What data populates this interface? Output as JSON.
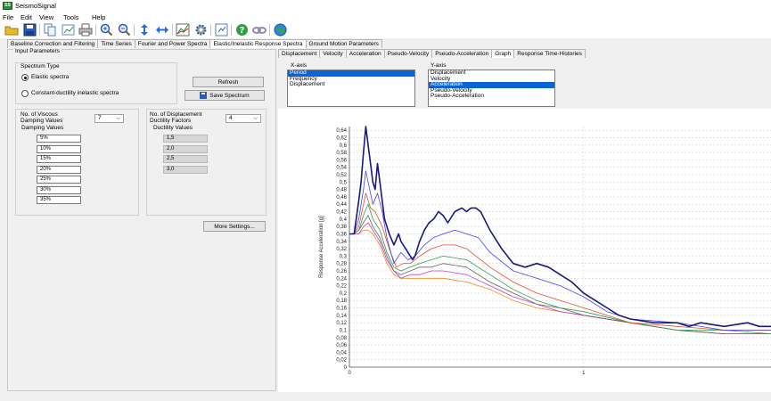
{
  "app": {
    "title": "SeismoSignal"
  },
  "menu": [
    "File",
    "Edit",
    "View",
    "Tools",
    "Help"
  ],
  "toolbar": [
    "open-folder",
    "save",
    "copy",
    "print",
    "zoom-in",
    "zoom-out",
    "vertical-arrows",
    "horizontal-arrows",
    "chart",
    "gear",
    "export",
    "help",
    "link",
    "globe"
  ],
  "main_tabs": [
    "Baseline Correction and Filtering",
    "Time Series",
    "Fourier and Power Spectra",
    "Elastic/Inelastic Response Spectra",
    "Ground Motion Parameters"
  ],
  "main_active": 3,
  "left": {
    "header": "Input Parameters",
    "spectrum_type": "Spectrum Type",
    "elastic": "Elastic spectra",
    "inelastic": "Constant-ductility inelastic spectra",
    "refresh": "Refresh",
    "save": "Save Spectrum",
    "viscous_l1": "No. of Viscous",
    "viscous_l2": "Damping Values",
    "viscous_value": "7",
    "damping_header": "Damping Values",
    "damping": [
      "5%",
      "10%",
      "15%",
      "20%",
      "25%",
      "30%",
      "35%"
    ],
    "ductility_l1": "No. of Displacement",
    "ductility_l2": "Ductility Factors",
    "ductility_value": "4",
    "ductility_header": "Ductility Values",
    "ductility": [
      "1,5",
      "2,0",
      "2,5",
      "3,0"
    ],
    "more": "More Settings..."
  },
  "sub_tabs": [
    "Displacement",
    "Velocity",
    "Acceleration",
    "Pseudo-Velocity",
    "Pseudo-Acceleration",
    "Graph",
    "Response Time-Histories"
  ],
  "sub_active": 5,
  "xaxis": {
    "label": "X-axis",
    "items": [
      "Period",
      "Frequency",
      "Displacement"
    ],
    "selected": 0
  },
  "yaxis": {
    "label": "Y-axis",
    "items": [
      "Displacement",
      "Velocity",
      "Acceleration",
      "Pseudo-Velocity",
      "Pseudo-Acceleration"
    ],
    "selected": 2
  },
  "chart_data": {
    "type": "line",
    "xlabel": "",
    "ylabel": "Response Acceleration [g]",
    "xlim": [
      0,
      1.8
    ],
    "ylim": [
      0,
      0.65
    ],
    "yticks": [
      "0",
      "0,02",
      "0,04",
      "0,06",
      "0,08",
      "0,1",
      "0,12",
      "0,14",
      "0,16",
      "0,18",
      "0,2",
      "0,22",
      "0,24",
      "0,26",
      "0,28",
      "0,3",
      "0,32",
      "0,34",
      "0,36",
      "0,38",
      "0,4",
      "0,42",
      "0,44",
      "0,46",
      "0,48",
      "0,5",
      "0,52",
      "0,54",
      "0,56",
      "0,58",
      "0,6",
      "0,62",
      "0,64"
    ],
    "xticks": [
      {
        "v": 0,
        "label": "0"
      },
      {
        "v": 1,
        "label": "1"
      }
    ],
    "grid": true,
    "series": [
      {
        "color": "#1a1a7a",
        "values": [
          [
            0,
            0.36
          ],
          [
            0.02,
            0.36
          ],
          [
            0.04,
            0.45
          ],
          [
            0.05,
            0.5
          ],
          [
            0.06,
            0.58
          ],
          [
            0.07,
            0.65
          ],
          [
            0.08,
            0.6
          ],
          [
            0.09,
            0.55
          ],
          [
            0.1,
            0.5
          ],
          [
            0.11,
            0.48
          ],
          [
            0.12,
            0.55
          ],
          [
            0.13,
            0.5
          ],
          [
            0.14,
            0.45
          ],
          [
            0.15,
            0.4
          ],
          [
            0.17,
            0.36
          ],
          [
            0.19,
            0.33
          ],
          [
            0.21,
            0.36
          ],
          [
            0.22,
            0.34
          ],
          [
            0.24,
            0.32
          ],
          [
            0.26,
            0.3
          ],
          [
            0.27,
            0.29
          ],
          [
            0.28,
            0.3
          ],
          [
            0.3,
            0.34
          ],
          [
            0.32,
            0.37
          ],
          [
            0.34,
            0.39
          ],
          [
            0.36,
            0.4
          ],
          [
            0.38,
            0.42
          ],
          [
            0.4,
            0.41
          ],
          [
            0.42,
            0.39
          ],
          [
            0.45,
            0.42
          ],
          [
            0.48,
            0.43
          ],
          [
            0.5,
            0.42
          ],
          [
            0.52,
            0.43
          ],
          [
            0.54,
            0.43
          ],
          [
            0.56,
            0.42
          ],
          [
            0.6,
            0.37
          ],
          [
            0.65,
            0.32
          ],
          [
            0.7,
            0.28
          ],
          [
            0.75,
            0.27
          ],
          [
            0.8,
            0.28
          ],
          [
            0.85,
            0.27
          ],
          [
            0.9,
            0.25
          ],
          [
            0.95,
            0.23
          ],
          [
            1.0,
            0.2
          ],
          [
            1.05,
            0.18
          ],
          [
            1.1,
            0.16
          ],
          [
            1.15,
            0.14
          ],
          [
            1.2,
            0.13
          ],
          [
            1.3,
            0.12
          ],
          [
            1.4,
            0.12
          ],
          [
            1.45,
            0.11
          ],
          [
            1.5,
            0.12
          ],
          [
            1.6,
            0.11
          ],
          [
            1.7,
            0.12
          ],
          [
            1.75,
            0.11
          ],
          [
            1.8,
            0.11
          ]
        ]
      },
      {
        "color": "#4444ee",
        "values": [
          [
            0,
            0.36
          ],
          [
            0.02,
            0.36
          ],
          [
            0.04,
            0.4
          ],
          [
            0.06,
            0.48
          ],
          [
            0.07,
            0.53
          ],
          [
            0.08,
            0.5
          ],
          [
            0.1,
            0.44
          ],
          [
            0.12,
            0.47
          ],
          [
            0.14,
            0.42
          ],
          [
            0.16,
            0.35
          ],
          [
            0.19,
            0.28
          ],
          [
            0.22,
            0.31
          ],
          [
            0.25,
            0.29
          ],
          [
            0.28,
            0.3
          ],
          [
            0.32,
            0.33
          ],
          [
            0.36,
            0.35
          ],
          [
            0.4,
            0.36
          ],
          [
            0.45,
            0.37
          ],
          [
            0.5,
            0.36
          ],
          [
            0.55,
            0.35
          ],
          [
            0.6,
            0.31
          ],
          [
            0.7,
            0.26
          ],
          [
            0.8,
            0.24
          ],
          [
            0.9,
            0.22
          ],
          [
            1.0,
            0.19
          ],
          [
            1.1,
            0.15
          ],
          [
            1.2,
            0.13
          ],
          [
            1.4,
            0.12
          ],
          [
            1.6,
            0.1
          ],
          [
            1.8,
            0.1
          ]
        ]
      },
      {
        "color": "#e05030",
        "values": [
          [
            0,
            0.36
          ],
          [
            0.02,
            0.36
          ],
          [
            0.04,
            0.38
          ],
          [
            0.06,
            0.44
          ],
          [
            0.07,
            0.47
          ],
          [
            0.09,
            0.43
          ],
          [
            0.11,
            0.42
          ],
          [
            0.14,
            0.38
          ],
          [
            0.17,
            0.32
          ],
          [
            0.2,
            0.27
          ],
          [
            0.23,
            0.28
          ],
          [
            0.26,
            0.28
          ],
          [
            0.3,
            0.3
          ],
          [
            0.35,
            0.32
          ],
          [
            0.4,
            0.33
          ],
          [
            0.45,
            0.33
          ],
          [
            0.5,
            0.32
          ],
          [
            0.6,
            0.27
          ],
          [
            0.7,
            0.23
          ],
          [
            0.8,
            0.2
          ],
          [
            0.9,
            0.18
          ],
          [
            1.0,
            0.16
          ],
          [
            1.2,
            0.12
          ],
          [
            1.4,
            0.11
          ],
          [
            1.6,
            0.1
          ],
          [
            1.8,
            0.1
          ]
        ]
      },
      {
        "color": "#30a050",
        "values": [
          [
            0,
            0.36
          ],
          [
            0.02,
            0.36
          ],
          [
            0.04,
            0.37
          ],
          [
            0.06,
            0.41
          ],
          [
            0.08,
            0.44
          ],
          [
            0.1,
            0.4
          ],
          [
            0.13,
            0.37
          ],
          [
            0.16,
            0.31
          ],
          [
            0.19,
            0.27
          ],
          [
            0.22,
            0.26
          ],
          [
            0.26,
            0.27
          ],
          [
            0.3,
            0.28
          ],
          [
            0.35,
            0.29
          ],
          [
            0.4,
            0.3
          ],
          [
            0.5,
            0.29
          ],
          [
            0.6,
            0.25
          ],
          [
            0.7,
            0.21
          ],
          [
            0.8,
            0.18
          ],
          [
            0.9,
            0.16
          ],
          [
            1.0,
            0.15
          ],
          [
            1.2,
            0.12
          ],
          [
            1.4,
            0.1
          ],
          [
            1.6,
            0.1
          ],
          [
            1.8,
            0.09
          ]
        ]
      },
      {
        "color": "#666666",
        "values": [
          [
            0,
            0.36
          ],
          [
            0.02,
            0.36
          ],
          [
            0.04,
            0.37
          ],
          [
            0.06,
            0.39
          ],
          [
            0.08,
            0.41
          ],
          [
            0.1,
            0.38
          ],
          [
            0.13,
            0.35
          ],
          [
            0.16,
            0.3
          ],
          [
            0.19,
            0.26
          ],
          [
            0.22,
            0.25
          ],
          [
            0.26,
            0.26
          ],
          [
            0.3,
            0.27
          ],
          [
            0.35,
            0.27
          ],
          [
            0.4,
            0.28
          ],
          [
            0.5,
            0.27
          ],
          [
            0.6,
            0.23
          ],
          [
            0.7,
            0.2
          ],
          [
            0.8,
            0.17
          ],
          [
            0.9,
            0.16
          ],
          [
            1.0,
            0.14
          ],
          [
            1.2,
            0.12
          ],
          [
            1.4,
            0.1
          ],
          [
            1.6,
            0.09
          ],
          [
            1.8,
            0.09
          ]
        ]
      },
      {
        "color": "#c040c0",
        "values": [
          [
            0,
            0.36
          ],
          [
            0.02,
            0.36
          ],
          [
            0.04,
            0.36
          ],
          [
            0.06,
            0.38
          ],
          [
            0.08,
            0.39
          ],
          [
            0.1,
            0.37
          ],
          [
            0.13,
            0.34
          ],
          [
            0.16,
            0.29
          ],
          [
            0.19,
            0.26
          ],
          [
            0.22,
            0.24
          ],
          [
            0.26,
            0.25
          ],
          [
            0.3,
            0.25
          ],
          [
            0.35,
            0.26
          ],
          [
            0.4,
            0.26
          ],
          [
            0.5,
            0.25
          ],
          [
            0.6,
            0.22
          ],
          [
            0.7,
            0.19
          ],
          [
            0.8,
            0.17
          ],
          [
            0.9,
            0.15
          ],
          [
            1.0,
            0.14
          ],
          [
            1.2,
            0.12
          ],
          [
            1.4,
            0.1
          ],
          [
            1.6,
            0.09
          ],
          [
            1.8,
            0.09
          ]
        ]
      },
      {
        "color": "#f08a1c",
        "values": [
          [
            0,
            0.36
          ],
          [
            0.02,
            0.36
          ],
          [
            0.04,
            0.36
          ],
          [
            0.06,
            0.37
          ],
          [
            0.08,
            0.37
          ],
          [
            0.1,
            0.36
          ],
          [
            0.13,
            0.33
          ],
          [
            0.16,
            0.28
          ],
          [
            0.19,
            0.25
          ],
          [
            0.22,
            0.24
          ],
          [
            0.26,
            0.24
          ],
          [
            0.3,
            0.24
          ],
          [
            0.35,
            0.24
          ],
          [
            0.4,
            0.24
          ],
          [
            0.5,
            0.23
          ],
          [
            0.6,
            0.21
          ],
          [
            0.7,
            0.18
          ],
          [
            0.8,
            0.16
          ],
          [
            0.9,
            0.15
          ],
          [
            1.0,
            0.14
          ],
          [
            1.2,
            0.12
          ],
          [
            1.4,
            0.1
          ],
          [
            1.6,
            0.09
          ],
          [
            1.8,
            0.09
          ]
        ]
      }
    ]
  }
}
